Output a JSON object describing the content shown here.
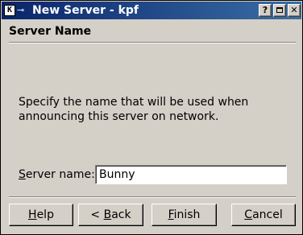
{
  "window": {
    "title": "New Server - kpf",
    "icon": "k-app-icon",
    "pin_icon": "pin-icon",
    "controls": {
      "help": "?",
      "maximize": "maximize-icon",
      "close": "✕"
    }
  },
  "page": {
    "title": "Server Name",
    "description": "Specify the name that will be used when announcing this server on network."
  },
  "form": {
    "server_name_label_accel": "S",
    "server_name_label_rest": "erver name:",
    "server_name_value": "Bunny"
  },
  "buttons": {
    "help_accel": "H",
    "help_rest": "elp",
    "back_prefix": "< ",
    "back_accel": "B",
    "back_rest": "ack",
    "finish_accel": "F",
    "finish_rest": "inish",
    "cancel_accel": "C",
    "cancel_rest": "ancel"
  },
  "colors": {
    "titlebar": "#0a246a",
    "face": "#d4d0c8"
  }
}
